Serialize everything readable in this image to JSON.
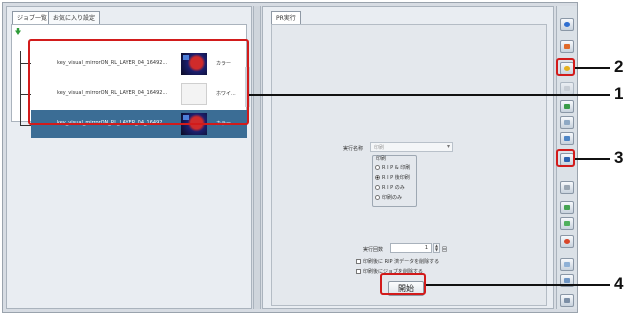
{
  "left_panel": {
    "tabs": [
      "ジョブ一覧",
      "お気に入り設定"
    ],
    "rows": [
      {
        "name": "key_visual_mirrorON_RL_LAYER_04_16492...",
        "label": "カラー",
        "thumb": "dark"
      },
      {
        "name": "key_visual_mirrorON_RL_LAYER_04_16492...",
        "label": "ホワイ...",
        "thumb": "light"
      },
      {
        "name": "key_visual_mirrorON_RL_LAYER_04_16492...",
        "label": "カラー",
        "thumb": "dark"
      }
    ]
  },
  "right_panel": {
    "tab": "PR実行",
    "exec_name_label": "実行名称",
    "exec_name_value": "印刷",
    "print_group_label": "印刷",
    "radio_options": [
      {
        "label": "R I P & 印刷",
        "selected": false
      },
      {
        "label": "R I P 後印刷",
        "selected": true
      },
      {
        "label": "R I P のみ",
        "selected": false
      },
      {
        "label": "印刷のみ",
        "selected": false
      }
    ],
    "count_label": "実行回数",
    "count_value": "1",
    "count_unit": "回",
    "check_1": "印刷後に RIP 済データを削除する",
    "check_2": "印刷後にジョブを削除する",
    "start_button": "開始"
  },
  "callouts": {
    "one": "1",
    "two": "2",
    "three": "3",
    "four": "4"
  },
  "colors": {
    "callout": "#d21b1b",
    "selected_row": "#3b6d95"
  }
}
